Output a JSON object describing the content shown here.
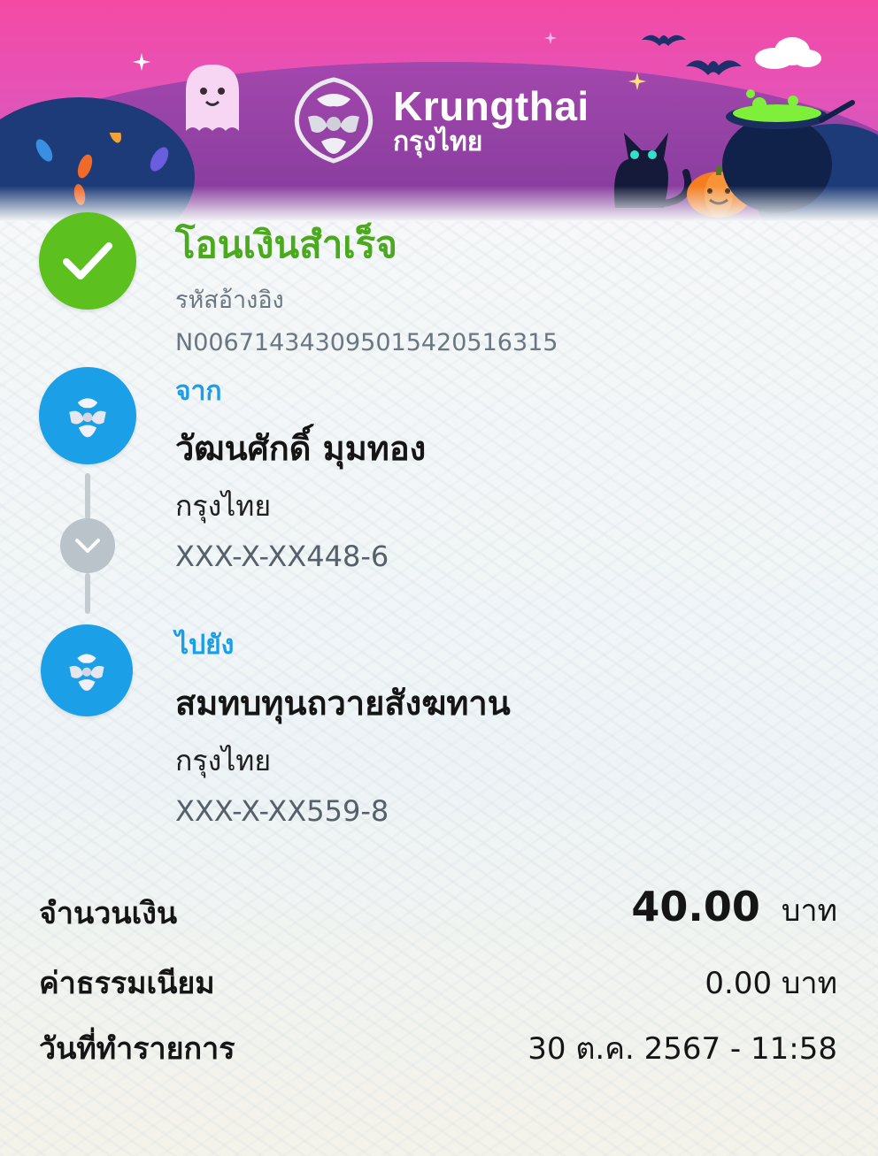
{
  "header": {
    "brand_en": "Krungthai",
    "brand_th": "กรุงไทย",
    "theme": "halloween"
  },
  "status": {
    "title": "โอนเงินสำเร็จ",
    "ref_label": "รหัสอ้างอิง",
    "ref_value": "N006714343095015420516315"
  },
  "from": {
    "label": "จาก",
    "name": "วัฒนศักดิ์ มุมทอง",
    "bank": "กรุงไทย",
    "account": "XXX-X-XX448-6"
  },
  "to": {
    "label": "ไปยัง",
    "name": "สมทบทุนถวายสังฆทาน",
    "bank": "กรุงไทย",
    "account": "XXX-X-XX559-8"
  },
  "summary": {
    "amount_label": "จำนวนเงิน",
    "amount_value": "40.00",
    "amount_unit": "บาท",
    "fee_label": "ค่าธรรมเนียม",
    "fee_value": "0.00 บาท",
    "date_label": "วันที่ทำรายการ",
    "date_value": "30 ต.ค. 2567 - 11:58"
  },
  "colors": {
    "success": "#5cc11f",
    "accent_blue": "#1a9ee6",
    "banner_pink": "#f44aa4",
    "banner_purple": "#7e3a98"
  }
}
